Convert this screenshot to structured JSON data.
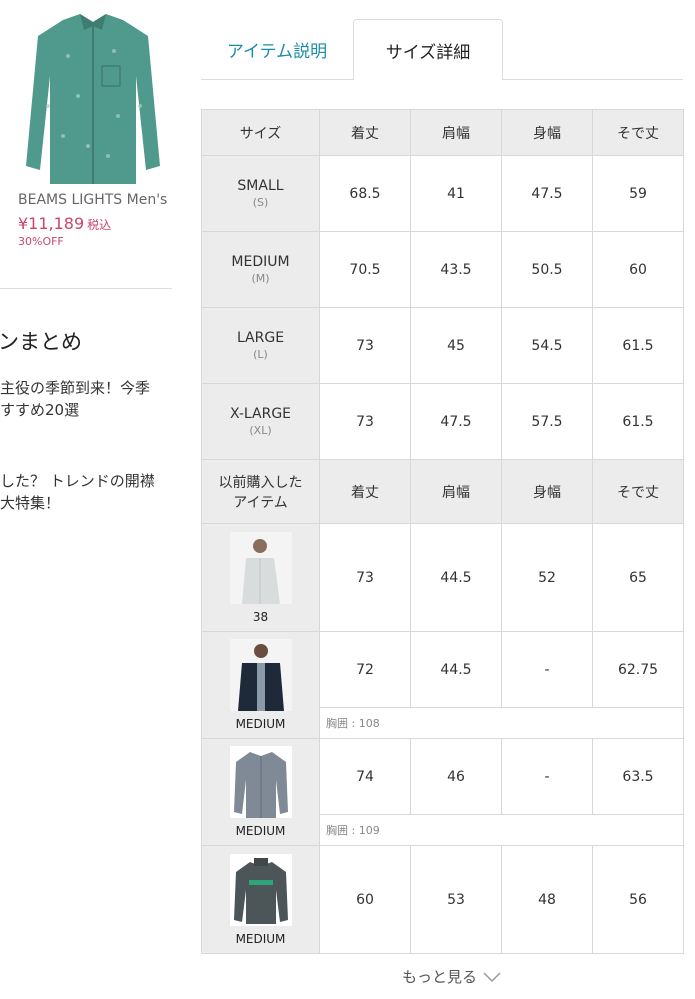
{
  "product": {
    "brand": "BEAMS LIGHTS Men's",
    "price": "¥11,189",
    "tax_label": "税込",
    "discount": "30%OFF"
  },
  "sidebar": {
    "headline": "ンまとめ",
    "articles": [
      {
        "line1": "主役の季節到来！今季",
        "line2": "すすめ20選"
      },
      {
        "line1": "した？ トレンドの開襟",
        "line2": "大特集！"
      }
    ]
  },
  "tabs": [
    {
      "label": "アイテム説明"
    },
    {
      "label": "サイズ詳細"
    }
  ],
  "size_table": {
    "headers": [
      "サイズ",
      "着丈",
      "肩幅",
      "身幅",
      "そで丈"
    ],
    "rows": [
      {
        "name": "SMALL",
        "code": "(S)",
        "values": [
          "68.5",
          "41",
          "47.5",
          "59"
        ]
      },
      {
        "name": "MEDIUM",
        "code": "(M)",
        "values": [
          "70.5",
          "43.5",
          "50.5",
          "60"
        ]
      },
      {
        "name": "LARGE",
        "code": "(L)",
        "values": [
          "73",
          "45",
          "54.5",
          "61.5"
        ]
      },
      {
        "name": "X-LARGE",
        "code": "(XL)",
        "values": [
          "73",
          "47.5",
          "57.5",
          "61.5"
        ]
      }
    ]
  },
  "purchased_table": {
    "headers": [
      "以前購入した",
      "アイテム",
      "着丈",
      "肩幅",
      "身幅",
      "そで丈"
    ],
    "rows": [
      {
        "size": "38",
        "values": [
          "73",
          "44.5",
          "52",
          "65"
        ],
        "chest": ""
      },
      {
        "size": "MEDIUM",
        "values": [
          "72",
          "44.5",
          "-",
          "62.75"
        ],
        "chest": "胸囲 : 108"
      },
      {
        "size": "MEDIUM",
        "values": [
          "74",
          "46",
          "-",
          "63.5"
        ],
        "chest": "胸囲 : 109"
      },
      {
        "size": "MEDIUM",
        "values": [
          "60",
          "53",
          "48",
          "56"
        ],
        "chest": ""
      }
    ]
  },
  "more_label": "もっと見る"
}
